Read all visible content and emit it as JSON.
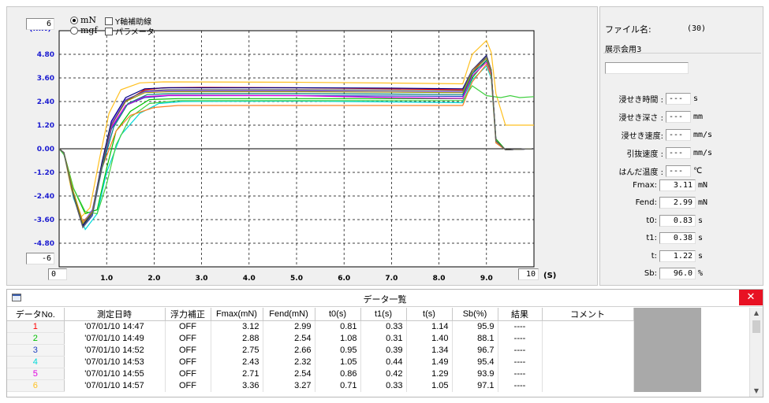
{
  "chart": {
    "unit_label": "(mN)",
    "options": {
      "radio_mn": "mN",
      "radio_mgf": "mgf",
      "check_y_aux": "Y軸補助線",
      "check_param": "パラメータ"
    },
    "ymax_input": "6",
    "ymin_input": "-6",
    "xmin_input": "0",
    "xmax_input": "10",
    "x_unit": "(S)"
  },
  "chart_data": {
    "type": "line",
    "title": "",
    "xlabel": "(S)",
    "ylabel": "(mN)",
    "xlim": [
      0,
      10
    ],
    "ylim": [
      -6,
      6
    ],
    "x_ticks": [
      "1.0",
      "2.0",
      "3.0",
      "4.0",
      "5.0",
      "6.0",
      "7.0",
      "8.0",
      "9.0"
    ],
    "y_ticks": [
      "4.80",
      "3.60",
      "2.40",
      "1.20",
      "0.00",
      "-1.20",
      "-2.40",
      "-3.60",
      "-4.80"
    ],
    "grid": true,
    "series": [
      {
        "color": "#ff0000",
        "points": [
          [
            0,
            0
          ],
          [
            0.1,
            -0.2
          ],
          [
            0.3,
            -2.3
          ],
          [
            0.5,
            -3.9
          ],
          [
            0.7,
            -3.2
          ],
          [
            0.9,
            -0.8
          ],
          [
            1.1,
            1.2
          ],
          [
            1.4,
            2.4
          ],
          [
            1.8,
            3.0
          ],
          [
            2.2,
            3.1
          ],
          [
            3,
            3.12
          ],
          [
            5,
            3.1
          ],
          [
            7,
            3.05
          ],
          [
            8.5,
            3.0
          ],
          [
            8.7,
            4.0
          ],
          [
            9,
            4.6
          ],
          [
            9.1,
            3.8
          ],
          [
            9.2,
            0.3
          ],
          [
            9.4,
            -0.05
          ],
          [
            10,
            0
          ]
        ]
      },
      {
        "color": "#00c000",
        "points": [
          [
            0,
            0
          ],
          [
            0.1,
            -0.2
          ],
          [
            0.3,
            -2.0
          ],
          [
            0.55,
            -3.3
          ],
          [
            0.8,
            -3.1
          ],
          [
            1.0,
            -1.0
          ],
          [
            1.2,
            0.9
          ],
          [
            1.5,
            1.9
          ],
          [
            1.9,
            2.5
          ],
          [
            2.5,
            2.55
          ],
          [
            5,
            2.55
          ],
          [
            7,
            2.55
          ],
          [
            8.5,
            2.55
          ],
          [
            8.7,
            3.6
          ],
          [
            9,
            4.5
          ],
          [
            9.1,
            3.9
          ],
          [
            9.2,
            0.5
          ],
          [
            9.4,
            -0.05
          ],
          [
            10,
            0
          ]
        ]
      },
      {
        "color": "#2040c0",
        "points": [
          [
            0,
            0
          ],
          [
            0.1,
            -0.2
          ],
          [
            0.3,
            -2.4
          ],
          [
            0.5,
            -4.0
          ],
          [
            0.7,
            -3.4
          ],
          [
            0.9,
            -1.0
          ],
          [
            1.1,
            1.0
          ],
          [
            1.4,
            2.2
          ],
          [
            1.8,
            2.6
          ],
          [
            2.3,
            2.7
          ],
          [
            5,
            2.7
          ],
          [
            7,
            2.68
          ],
          [
            8.5,
            2.66
          ],
          [
            8.7,
            3.8
          ],
          [
            9,
            4.7
          ],
          [
            9.1,
            4.0
          ],
          [
            9.2,
            0.4
          ],
          [
            9.4,
            -0.05
          ],
          [
            10,
            0
          ]
        ]
      },
      {
        "color": "#00d8d8",
        "points": [
          [
            0,
            0
          ],
          [
            0.1,
            -0.2
          ],
          [
            0.3,
            -2.5
          ],
          [
            0.55,
            -4.1
          ],
          [
            0.8,
            -3.3
          ],
          [
            1.0,
            -1.2
          ],
          [
            1.3,
            0.7
          ],
          [
            1.7,
            1.8
          ],
          [
            2.1,
            2.3
          ],
          [
            2.6,
            2.4
          ],
          [
            5,
            2.42
          ],
          [
            7,
            2.38
          ],
          [
            8.5,
            2.34
          ],
          [
            8.7,
            3.5
          ],
          [
            9,
            4.2
          ],
          [
            9.1,
            3.6
          ],
          [
            9.2,
            0.3
          ],
          [
            9.4,
            -0.05
          ],
          [
            10,
            0
          ]
        ]
      },
      {
        "color": "#e000e0",
        "points": [
          [
            0,
            0
          ],
          [
            0.1,
            -0.2
          ],
          [
            0.3,
            -2.3
          ],
          [
            0.5,
            -3.9
          ],
          [
            0.7,
            -3.2
          ],
          [
            0.9,
            -0.9
          ],
          [
            1.1,
            1.1
          ],
          [
            1.4,
            2.2
          ],
          [
            1.8,
            2.65
          ],
          [
            2.3,
            2.72
          ],
          [
            5,
            2.7
          ],
          [
            7,
            2.6
          ],
          [
            8.5,
            2.56
          ],
          [
            8.7,
            3.7
          ],
          [
            9,
            4.4
          ],
          [
            9.1,
            3.8
          ],
          [
            9.2,
            0.4
          ],
          [
            9.4,
            -0.05
          ],
          [
            10,
            0
          ]
        ]
      },
      {
        "color": "#ffc020",
        "points": [
          [
            0,
            0
          ],
          [
            0.1,
            -0.2
          ],
          [
            0.25,
            -2.0
          ],
          [
            0.45,
            -3.5
          ],
          [
            0.65,
            -3.0
          ],
          [
            0.85,
            -0.5
          ],
          [
            1.05,
            1.8
          ],
          [
            1.3,
            3.0
          ],
          [
            1.7,
            3.35
          ],
          [
            2.2,
            3.4
          ],
          [
            5,
            3.38
          ],
          [
            7,
            3.34
          ],
          [
            8.5,
            3.3
          ],
          [
            8.7,
            4.8
          ],
          [
            9,
            5.5
          ],
          [
            9.1,
            4.9
          ],
          [
            9.2,
            2.8
          ],
          [
            9.4,
            1.2
          ],
          [
            10,
            1.2
          ]
        ]
      },
      {
        "color": "#40d040",
        "points": [
          [
            0,
            0
          ],
          [
            0.1,
            -0.3
          ],
          [
            0.3,
            -2.0
          ],
          [
            0.55,
            -3.2
          ],
          [
            0.8,
            -3.3
          ],
          [
            1.0,
            -1.8
          ],
          [
            1.2,
            0.2
          ],
          [
            1.5,
            1.6
          ],
          [
            1.9,
            2.3
          ],
          [
            2.5,
            2.45
          ],
          [
            5,
            2.45
          ],
          [
            7,
            2.45
          ],
          [
            8.5,
            2.45
          ],
          [
            8.7,
            3.2
          ],
          [
            9,
            2.7
          ],
          [
            9.3,
            2.6
          ],
          [
            9.5,
            2.7
          ],
          [
            9.7,
            2.6
          ],
          [
            10,
            2.65
          ]
        ]
      },
      {
        "color": "#ff8020",
        "points": [
          [
            0,
            0
          ],
          [
            0.1,
            -0.2
          ],
          [
            0.3,
            -2.2
          ],
          [
            0.5,
            -3.7
          ],
          [
            0.7,
            -3.2
          ],
          [
            0.9,
            -1.0
          ],
          [
            1.2,
            0.9
          ],
          [
            1.5,
            1.7
          ],
          [
            2.0,
            2.1
          ],
          [
            2.5,
            2.2
          ],
          [
            5,
            2.2
          ],
          [
            7,
            2.2
          ],
          [
            8.5,
            2.2
          ],
          [
            8.7,
            3.4
          ],
          [
            9,
            4.3
          ],
          [
            9.1,
            3.7
          ],
          [
            9.2,
            0.3
          ],
          [
            9.4,
            -0.05
          ],
          [
            10,
            0
          ]
        ]
      },
      {
        "color": "#8040ff",
        "points": [
          [
            0,
            0
          ],
          [
            0.1,
            -0.2
          ],
          [
            0.3,
            -2.3
          ],
          [
            0.5,
            -3.8
          ],
          [
            0.7,
            -3.1
          ],
          [
            0.9,
            -0.8
          ],
          [
            1.1,
            1.3
          ],
          [
            1.4,
            2.5
          ],
          [
            1.8,
            2.9
          ],
          [
            2.2,
            2.95
          ],
          [
            5,
            2.95
          ],
          [
            7,
            2.9
          ],
          [
            8.5,
            2.88
          ],
          [
            8.7,
            3.9
          ],
          [
            9,
            4.6
          ],
          [
            9.1,
            3.9
          ],
          [
            9.2,
            0.4
          ],
          [
            9.4,
            -0.05
          ],
          [
            10,
            0
          ]
        ]
      },
      {
        "color": "#008080",
        "points": [
          [
            0,
            0
          ],
          [
            0.1,
            -0.2
          ],
          [
            0.3,
            -2.4
          ],
          [
            0.5,
            -3.9
          ],
          [
            0.7,
            -3.3
          ],
          [
            0.9,
            -1.0
          ],
          [
            1.15,
            1.1
          ],
          [
            1.45,
            2.3
          ],
          [
            1.85,
            2.75
          ],
          [
            2.3,
            2.8
          ],
          [
            5,
            2.8
          ],
          [
            7,
            2.78
          ],
          [
            8.5,
            2.75
          ],
          [
            8.7,
            3.8
          ],
          [
            9,
            4.5
          ],
          [
            9.1,
            3.9
          ],
          [
            9.2,
            0.4
          ],
          [
            9.4,
            -0.05
          ],
          [
            10,
            0
          ]
        ]
      },
      {
        "color": "#000080",
        "points": [
          [
            0,
            0
          ],
          [
            0.1,
            -0.2
          ],
          [
            0.3,
            -2.3
          ],
          [
            0.5,
            -3.9
          ],
          [
            0.7,
            -3.2
          ],
          [
            0.9,
            -0.7
          ],
          [
            1.1,
            1.4
          ],
          [
            1.4,
            2.6
          ],
          [
            1.8,
            3.05
          ],
          [
            2.3,
            3.1
          ],
          [
            5,
            3.1
          ],
          [
            7,
            3.08
          ],
          [
            8.5,
            3.05
          ],
          [
            8.7,
            4.0
          ],
          [
            9,
            4.75
          ],
          [
            9.1,
            4.0
          ],
          [
            9.2,
            0.4
          ],
          [
            9.4,
            -0.05
          ],
          [
            10,
            0
          ]
        ]
      },
      {
        "color": "#a0a000",
        "points": [
          [
            0,
            0
          ],
          [
            0.1,
            -0.2
          ],
          [
            0.3,
            -2.2
          ],
          [
            0.5,
            -3.8
          ],
          [
            0.7,
            -3.2
          ],
          [
            0.9,
            -0.9
          ],
          [
            1.1,
            1.2
          ],
          [
            1.4,
            2.4
          ],
          [
            1.8,
            2.85
          ],
          [
            2.3,
            2.9
          ],
          [
            5,
            2.9
          ],
          [
            7,
            2.88
          ],
          [
            8.5,
            2.85
          ],
          [
            8.7,
            3.9
          ],
          [
            9,
            4.6
          ],
          [
            9.1,
            3.9
          ],
          [
            9.2,
            0.4
          ],
          [
            9.4,
            -0.05
          ],
          [
            10,
            0
          ]
        ]
      },
      {
        "color": "#606060",
        "points": [
          [
            0,
            0
          ],
          [
            0.1,
            -0.2
          ],
          [
            0.3,
            -2.4
          ],
          [
            0.5,
            -4.0
          ],
          [
            0.7,
            -3.3
          ],
          [
            0.9,
            -0.9
          ],
          [
            1.1,
            1.2
          ],
          [
            1.4,
            2.45
          ],
          [
            1.8,
            2.95
          ],
          [
            2.3,
            3.0
          ],
          [
            5,
            3.0
          ],
          [
            7,
            2.98
          ],
          [
            8.5,
            2.95
          ],
          [
            8.7,
            4.0
          ],
          [
            9,
            4.7
          ],
          [
            9.1,
            4.0
          ],
          [
            9.2,
            0.4
          ],
          [
            9.4,
            -0.05
          ],
          [
            10,
            0
          ]
        ]
      }
    ]
  },
  "info": {
    "filename_label": "ファイル名:",
    "filename_value": "(30)",
    "file_title": "展示会用3",
    "blank_field": "",
    "params": [
      {
        "label": "浸せき時間 :",
        "value": "---",
        "unit": "s"
      },
      {
        "label": "浸せき深さ :",
        "value": "---",
        "unit": "mm"
      },
      {
        "label": "浸せき速度:",
        "value": "---",
        "unit": "mm/s"
      },
      {
        "label": "引抜速度 :",
        "value": "---",
        "unit": "mm/s"
      },
      {
        "label": "はんだ温度 :",
        "value": "---",
        "unit": "℃"
      }
    ],
    "results": [
      {
        "label": "Fmax:",
        "value": "3.11",
        "unit": "mN"
      },
      {
        "label": "Fend:",
        "value": "2.99",
        "unit": "mN"
      },
      {
        "label": "t0:",
        "value": "0.83",
        "unit": "s"
      },
      {
        "label": "t1:",
        "value": "0.38",
        "unit": "s"
      },
      {
        "label": "t:",
        "value": "1.22",
        "unit": "s"
      },
      {
        "label": "Sb:",
        "value": "96.0",
        "unit": "%"
      }
    ]
  },
  "data_window": {
    "title": "データ一覧",
    "close_glyph": "✕",
    "scroll_up": "▲",
    "scroll_down": "▼",
    "columns": [
      "データNo.",
      "測定日時",
      "浮力補正",
      "Fmax(mN)",
      "Fend(mN)",
      "t0(s)",
      "t1(s)",
      "t(s)",
      "Sb(%)",
      "結果",
      "コメント"
    ],
    "rows": [
      {
        "no": "1",
        "no_color": "#ff0000",
        "date": "'07/01/10 14:47",
        "buoy": "OFF",
        "fmax": "3.12",
        "fend": "2.99",
        "t0": "0.81",
        "t1": "0.33",
        "t": "1.14",
        "sb": "95.9",
        "result": "----",
        "comment": ""
      },
      {
        "no": "2",
        "no_color": "#00c000",
        "date": "'07/01/10 14:49",
        "buoy": "OFF",
        "fmax": "2.88",
        "fend": "2.54",
        "t0": "1.08",
        "t1": "0.31",
        "t": "1.40",
        "sb": "88.1",
        "result": "----",
        "comment": ""
      },
      {
        "no": "3",
        "no_color": "#2040c0",
        "date": "'07/01/10 14:52",
        "buoy": "OFF",
        "fmax": "2.75",
        "fend": "2.66",
        "t0": "0.95",
        "t1": "0.39",
        "t": "1.34",
        "sb": "96.7",
        "result": "----",
        "comment": ""
      },
      {
        "no": "4",
        "no_color": "#00d8d8",
        "date": "'07/01/10 14:53",
        "buoy": "OFF",
        "fmax": "2.43",
        "fend": "2.32",
        "t0": "1.05",
        "t1": "0.44",
        "t": "1.49",
        "sb": "95.4",
        "result": "----",
        "comment": ""
      },
      {
        "no": "5",
        "no_color": "#e000e0",
        "date": "'07/01/10 14:55",
        "buoy": "OFF",
        "fmax": "2.71",
        "fend": "2.54",
        "t0": "0.86",
        "t1": "0.42",
        "t": "1.29",
        "sb": "93.9",
        "result": "----",
        "comment": ""
      },
      {
        "no": "6",
        "no_color": "#ffc020",
        "date": "'07/01/10 14:57",
        "buoy": "OFF",
        "fmax": "3.36",
        "fend": "3.27",
        "t0": "0.71",
        "t1": "0.33",
        "t": "1.05",
        "sb": "97.1",
        "result": "----",
        "comment": ""
      }
    ]
  }
}
